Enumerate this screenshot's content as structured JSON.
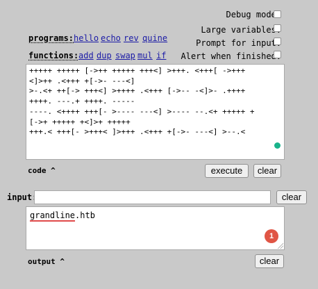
{
  "options": {
    "debug_label": "Debug mode:",
    "large_vars_label": "Large variables:",
    "prompt_label": "Prompt for input:",
    "alert_label": "Alert when finished:"
  },
  "programs": {
    "label": "programs:",
    "items": [
      "hello",
      "echo",
      "rev",
      "quine"
    ]
  },
  "functions": {
    "label": "functions:",
    "items": [
      "add",
      "dup",
      "swap",
      "mul",
      "if"
    ]
  },
  "code": {
    "lines": [
      "+++++ +++++ [->++ +++++ +++<] >+++. <+++[ ->+++",
      "<]>++ .<+++ +[->- ---<]",
      ">-.<+ ++[-> +++<] >++++ .<+++ [->-- -<]>- .++++",
      "++++. ---.+ ++++. -----",
      "----. <++++ +++[- >---- ---<] >---- --.<+ +++++ +",
      "[->+ +++++ +<]>+ +++++",
      "+++.< +++[- >+++< ]>+++ .<+++ +[->- ---<] >--.<"
    ],
    "label": "code ^",
    "execute_label": "execute",
    "clear_label": "clear",
    "status_color": "#19b38b"
  },
  "input": {
    "label": "input:",
    "value": "",
    "clear_label": "clear"
  },
  "output": {
    "text_underlined": "grandline",
    "text_rest": ".htb",
    "badge_count": "1",
    "badge_color": "#e05545",
    "label": "output ^",
    "clear_label": "clear"
  }
}
